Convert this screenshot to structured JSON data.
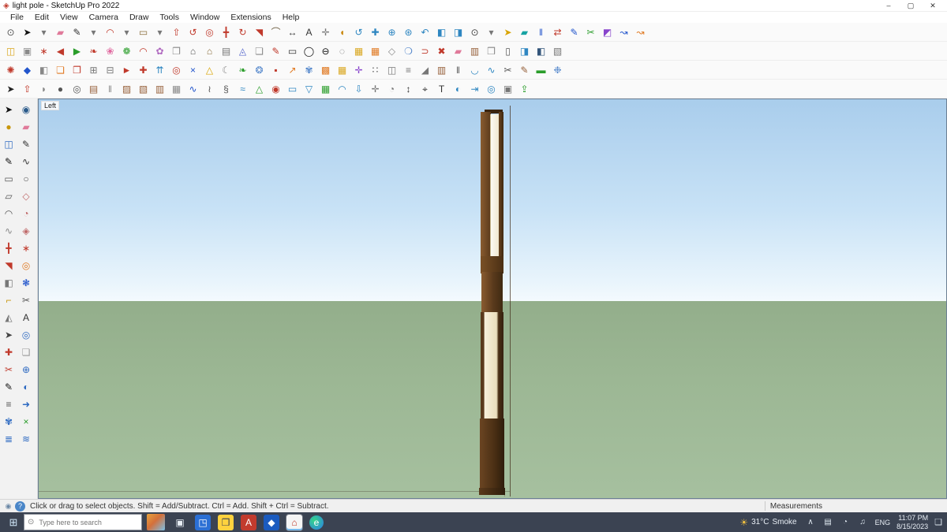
{
  "window": {
    "title": "light pole - SketchUp Pro 2022",
    "controls": {
      "minimize": "–",
      "maximize": "▢",
      "close": "✕"
    }
  },
  "menubar": {
    "items": [
      {
        "n": "menu-file",
        "label": "File"
      },
      {
        "n": "menu-edit",
        "label": "Edit"
      },
      {
        "n": "menu-view",
        "label": "View"
      },
      {
        "n": "menu-camera",
        "label": "Camera"
      },
      {
        "n": "menu-draw",
        "label": "Draw"
      },
      {
        "n": "menu-tools",
        "label": "Tools"
      },
      {
        "n": "menu-window",
        "label": "Window"
      },
      {
        "n": "menu-extensions",
        "label": "Extensions"
      },
      {
        "n": "menu-help",
        "label": "Help"
      }
    ]
  },
  "toolbars": {
    "row1": [
      {
        "n": "zoom-tool",
        "g": "⊙",
        "c": "#555"
      },
      {
        "n": "select",
        "g": "➤",
        "c": "#111"
      },
      {
        "n": "select-dropdown",
        "g": "▾",
        "c": "#777"
      },
      {
        "n": "eraser",
        "g": "▰",
        "c": "#e07a9a"
      },
      {
        "n": "line",
        "g": "✎",
        "c": "#333"
      },
      {
        "n": "line-dropdown",
        "g": "▾",
        "c": "#777"
      },
      {
        "n": "arc",
        "g": "◠",
        "c": "#c0392b"
      },
      {
        "n": "arc-dropdown",
        "g": "▾",
        "c": "#777"
      },
      {
        "n": "shapes",
        "g": "▭",
        "c": "#8a6d3b"
      },
      {
        "n": "shapes-dropdown",
        "g": "▾",
        "c": "#777"
      },
      {
        "n": "push-pull",
        "g": "⇧",
        "c": "#c0392b"
      },
      {
        "n": "follow-me",
        "g": "↺",
        "c": "#c0392b"
      },
      {
        "n": "offset",
        "g": "◎",
        "c": "#c0392b"
      },
      {
        "n": "move",
        "g": "╋",
        "c": "#c0392b"
      },
      {
        "n": "rotate",
        "g": "↻",
        "c": "#c0392b"
      },
      {
        "n": "scale",
        "g": "◥",
        "c": "#c0392b"
      },
      {
        "n": "tape-measure",
        "g": "⌒",
        "c": "#6b5b3e"
      },
      {
        "n": "dimension",
        "g": "↔",
        "c": "#333"
      },
      {
        "n": "text",
        "g": "A",
        "c": "#333"
      },
      {
        "n": "axes",
        "g": "✛",
        "c": "#777"
      },
      {
        "n": "paint-bucket",
        "g": "◖",
        "c": "#c8860a"
      },
      {
        "n": "orbit",
        "g": "↺",
        "c": "#2e86c1"
      },
      {
        "n": "pan",
        "g": "✚",
        "c": "#2e86c1"
      },
      {
        "n": "zoom-in",
        "g": "⊕",
        "c": "#2e86c1"
      },
      {
        "n": "zoom-extents",
        "g": "⊛",
        "c": "#2e86c1"
      },
      {
        "n": "previous-view",
        "g": "↶",
        "c": "#2e86c1"
      },
      {
        "n": "section-plane",
        "g": "◧",
        "c": "#2e86c1"
      },
      {
        "n": "section-fill",
        "g": "◨",
        "c": "#2e86c1"
      },
      {
        "n": "search",
        "g": "⊙",
        "c": "#444"
      },
      {
        "n": "search-dropdown",
        "g": "▾",
        "c": "#777"
      },
      {
        "n": "flip-yellow",
        "g": "➤",
        "c": "#d9a400"
      },
      {
        "n": "fill-teal",
        "g": "▰",
        "c": "#17a2a2"
      },
      {
        "n": "solid-tools",
        "g": "‖",
        "c": "#2255cc"
      },
      {
        "n": "swap-red-blue",
        "g": "⇄",
        "c": "#c0392b"
      },
      {
        "n": "pencil-blue",
        "g": "✎",
        "c": "#2255cc"
      },
      {
        "n": "scissors-green",
        "g": "✂",
        "c": "#2a9d2a"
      },
      {
        "n": "box-purple",
        "g": "◩",
        "c": "#8844cc"
      },
      {
        "n": "curl-blue",
        "g": "↝",
        "c": "#2255cc"
      },
      {
        "n": "curl-orange",
        "g": "↝",
        "c": "#e07820"
      }
    ],
    "row2": [
      {
        "n": "component-yellow",
        "g": "◫",
        "c": "#d9a61e"
      },
      {
        "n": "group-gray",
        "g": "▣",
        "c": "#8a8a8a"
      },
      {
        "n": "explode-red",
        "g": "∗",
        "c": "#c0392b"
      },
      {
        "n": "arrow-red",
        "g": "◀",
        "c": "#c0392b"
      },
      {
        "n": "arrow-green",
        "g": "▶",
        "c": "#2a9d2a"
      },
      {
        "n": "drop-red",
        "g": "❧",
        "c": "#c0392b"
      },
      {
        "n": "petal-pink",
        "g": "❀",
        "c": "#e06aa0"
      },
      {
        "n": "leaf-green",
        "g": "❁",
        "c": "#2a9d2a"
      },
      {
        "n": "arc-tool-red",
        "g": "◠",
        "c": "#c0392b"
      },
      {
        "n": "flower-violet",
        "g": "✿",
        "c": "#b06ac0"
      },
      {
        "n": "pages",
        "g": "❐",
        "c": "#888"
      },
      {
        "n": "house",
        "g": "⌂",
        "c": "#555"
      },
      {
        "n": "house-2",
        "g": "⌂",
        "c": "#8a6d3b"
      },
      {
        "n": "columns",
        "g": "▤",
        "c": "#777"
      },
      {
        "n": "fredoscale",
        "g": "◬",
        "c": "#5566cc"
      },
      {
        "n": "doc",
        "g": "❏",
        "c": "#888"
      },
      {
        "n": "pencil-red",
        "g": "✎",
        "c": "#c0392b"
      },
      {
        "n": "frame",
        "g": "▭",
        "c": "#333"
      },
      {
        "n": "oval-black",
        "g": "◯",
        "c": "#111"
      },
      {
        "n": "oval-filled",
        "g": "⊖",
        "c": "#111"
      },
      {
        "n": "oval-dashed",
        "g": "◌",
        "c": "#666"
      },
      {
        "n": "grid-yellow",
        "g": "▦",
        "c": "#d9a61e"
      },
      {
        "n": "grid-orange",
        "g": "▦",
        "c": "#e07820"
      },
      {
        "n": "hexagon",
        "g": "◇",
        "c": "#888"
      },
      {
        "n": "bubble-blue",
        "g": "❍",
        "c": "#5588cc"
      },
      {
        "n": "magnet-red",
        "g": "⊃",
        "c": "#c0392b"
      },
      {
        "n": "pin-red",
        "g": "✖",
        "c": "#c0392b"
      },
      {
        "n": "eraser-pink",
        "g": "▰",
        "c": "#e07a9a"
      },
      {
        "n": "panel-brown",
        "g": "▥",
        "c": "#96603a"
      },
      {
        "n": "book",
        "g": "❒",
        "c": "#888"
      },
      {
        "n": "door",
        "g": "▯",
        "c": "#555"
      },
      {
        "n": "display-blue",
        "g": "◨",
        "c": "#2e86c1"
      },
      {
        "n": "screen-navy",
        "g": "◧",
        "c": "#33557a"
      },
      {
        "n": "board-hatch",
        "g": "▧",
        "c": "#777"
      }
    ],
    "row3": [
      {
        "n": "burst-red",
        "g": "✺",
        "c": "#c0392b"
      },
      {
        "n": "diamond-blue",
        "g": "◆",
        "c": "#2255cc"
      },
      {
        "n": "half-square",
        "g": "◧",
        "c": "#888"
      },
      {
        "n": "page-orange",
        "g": "❏",
        "c": "#e07820"
      },
      {
        "n": "doc-red",
        "g": "❐",
        "c": "#c0392b"
      },
      {
        "n": "window-grid",
        "g": "⊞",
        "c": "#777"
      },
      {
        "n": "window-minus",
        "g": "⊟",
        "c": "#777"
      },
      {
        "n": "flag-red",
        "g": "►",
        "c": "#c0392b"
      },
      {
        "n": "cross-red",
        "g": "✚",
        "c": "#c0392b"
      },
      {
        "n": "arrows-up",
        "g": "⇈",
        "c": "#2e86c1"
      },
      {
        "n": "target-red",
        "g": "◎",
        "c": "#c0392b"
      },
      {
        "n": "x-blue",
        "g": "×",
        "c": "#2255cc"
      },
      {
        "n": "warning-triangle",
        "g": "△",
        "c": "#d9a400"
      },
      {
        "n": "moon",
        "g": "☾",
        "c": "#888"
      },
      {
        "n": "leaf-2",
        "g": "❧",
        "c": "#2a9d2a"
      },
      {
        "n": "wheel-blue",
        "g": "❂",
        "c": "#5588cc"
      },
      {
        "n": "box-red-small",
        "g": "▪",
        "c": "#c0392b"
      },
      {
        "n": "arrow-diag-orange",
        "g": "↗",
        "c": "#e07820"
      },
      {
        "n": "swirl-blue",
        "g": "✾",
        "c": "#5588cc"
      },
      {
        "n": "grid-orange-2",
        "g": "▩",
        "c": "#e07820"
      },
      {
        "n": "grid-gold",
        "g": "▦",
        "c": "#d9a61e"
      },
      {
        "n": "plus-purple",
        "g": "✛",
        "c": "#8844cc"
      },
      {
        "n": "dots-grid",
        "g": "∷",
        "c": "#555"
      },
      {
        "n": "cube-outline",
        "g": "◫",
        "c": "#777"
      },
      {
        "n": "stairs",
        "g": "≡",
        "c": "#777"
      },
      {
        "n": "ramp",
        "g": "◢",
        "c": "#777"
      },
      {
        "n": "fence-brown",
        "g": "▥",
        "c": "#96603a"
      },
      {
        "n": "pipes",
        "g": "‖",
        "c": "#555"
      },
      {
        "n": "arc-blue",
        "g": "◡",
        "c": "#2e86c1"
      },
      {
        "n": "wave-blue",
        "g": "∿",
        "c": "#2e86c1"
      },
      {
        "n": "scissors",
        "g": "✂",
        "c": "#555"
      },
      {
        "n": "brush-brown",
        "g": "✎",
        "c": "#96603a"
      },
      {
        "n": "roller-green",
        "g": "▬",
        "c": "#2a9d2a"
      },
      {
        "n": "spray-blue",
        "g": "❉",
        "c": "#5588cc"
      }
    ],
    "row4": [
      {
        "n": "select-2",
        "g": "➤",
        "c": "#222"
      },
      {
        "n": "push-red",
        "g": "⇧",
        "c": "#c0392b"
      },
      {
        "n": "shell",
        "g": "◗",
        "c": "#888"
      },
      {
        "n": "disc",
        "g": "●",
        "c": "#555"
      },
      {
        "n": "donut",
        "g": "◎",
        "c": "#555"
      },
      {
        "n": "panel-wood",
        "g": "▤",
        "c": "#96603a"
      },
      {
        "n": "pipe-pair",
        "g": "‖",
        "c": "#888"
      },
      {
        "n": "board-diag",
        "g": "▨",
        "c": "#96603a"
      },
      {
        "n": "board-diag-2",
        "g": "▧",
        "c": "#96603a"
      },
      {
        "n": "fence-2",
        "g": "▥",
        "c": "#96603a"
      },
      {
        "n": "grid-2",
        "g": "▦",
        "c": "#888"
      },
      {
        "n": "curve-blue",
        "g": "∿",
        "c": "#2255cc"
      },
      {
        "n": "spring",
        "g": "≀",
        "c": "#555"
      },
      {
        "n": "helix",
        "g": "§",
        "c": "#555"
      },
      {
        "n": "wave-2",
        "g": "≈",
        "c": "#2e86c1"
      },
      {
        "n": "terrain",
        "g": "△",
        "c": "#2a9d2a"
      },
      {
        "n": "stamp-red",
        "g": "◉",
        "c": "#c0392b"
      },
      {
        "n": "flatten",
        "g": "▭",
        "c": "#2e86c1"
      },
      {
        "n": "drape",
        "g": "▽",
        "c": "#2e86c1"
      },
      {
        "n": "mesh-green",
        "g": "▦",
        "c": "#2a9d2a"
      },
      {
        "n": "smooth-arc",
        "g": "◠",
        "c": "#2e86c1"
      },
      {
        "n": "arrow-down",
        "g": "⇩",
        "c": "#2e86c1"
      },
      {
        "n": "axes-2",
        "g": "✛",
        "c": "#777"
      },
      {
        "n": "protractor",
        "g": "◔",
        "c": "#777"
      },
      {
        "n": "dim-vertical",
        "g": "↕",
        "c": "#333"
      },
      {
        "n": "label-tag",
        "g": "⌖",
        "c": "#333"
      },
      {
        "n": "text-3d",
        "g": "T",
        "c": "#333"
      },
      {
        "n": "look-around",
        "g": "◐",
        "c": "#2e86c1"
      },
      {
        "n": "walk",
        "g": "⇥",
        "c": "#2e86c1"
      },
      {
        "n": "position-camera",
        "g": "◎",
        "c": "#2e86c1"
      },
      {
        "n": "image-frame",
        "g": "▣",
        "c": "#777"
      },
      {
        "n": "export-up",
        "g": "⇪",
        "c": "#2a9d2a"
      }
    ],
    "left": [
      {
        "n": "select",
        "g": "➤",
        "c": "#111"
      },
      {
        "n": "orbit-eye",
        "g": "◉",
        "c": "#2a5a8a"
      },
      {
        "n": "coin-gold",
        "g": "●",
        "c": "#c8960a"
      },
      {
        "n": "card-pink",
        "g": "▰",
        "c": "#e07a9a"
      },
      {
        "n": "cube-blue",
        "g": "◫",
        "c": "#2e6ac1"
      },
      {
        "n": "pencil",
        "g": "✎",
        "c": "#333"
      },
      {
        "n": "pencil-2",
        "g": "✎",
        "c": "#111"
      },
      {
        "n": "freehand",
        "g": "∿",
        "c": "#333"
      },
      {
        "n": "rectangle",
        "g": "▭",
        "c": "#555"
      },
      {
        "n": "circle",
        "g": "○",
        "c": "#555"
      },
      {
        "n": "rotated-rect",
        "g": "▱",
        "c": "#555"
      },
      {
        "n": "polygon",
        "g": "◇",
        "c": "#c06a6a"
      },
      {
        "n": "arc-tool",
        "g": "◠",
        "c": "#555"
      },
      {
        "n": "pie",
        "g": "◔",
        "c": "#c06a6a"
      },
      {
        "n": "curve",
        "g": "∿",
        "c": "#888"
      },
      {
        "n": "diamond-pink",
        "g": "◈",
        "c": "#c06a6a"
      },
      {
        "n": "move",
        "g": "╋",
        "c": "#c0392b"
      },
      {
        "n": "burst",
        "g": "∗",
        "c": "#c0392b"
      },
      {
        "n": "scale",
        "g": "◥",
        "c": "#c0392b"
      },
      {
        "n": "offset-orange",
        "g": "◎",
        "c": "#e07820"
      },
      {
        "n": "half-grid",
        "g": "◧",
        "c": "#777"
      },
      {
        "n": "flower-blue",
        "g": "❃",
        "c": "#2255cc"
      },
      {
        "n": "key-gold",
        "g": "⌐",
        "c": "#c8960a"
      },
      {
        "n": "scissors",
        "g": "✂",
        "c": "#555"
      },
      {
        "n": "triangle-half",
        "g": "◭",
        "c": "#777"
      },
      {
        "n": "text-box",
        "g": "A",
        "c": "#333"
      },
      {
        "n": "select-small",
        "g": "➤",
        "c": "#444"
      },
      {
        "n": "orbit-blue",
        "g": "◎",
        "c": "#2e6ac1"
      },
      {
        "n": "pin-cross",
        "g": "✚",
        "c": "#c0392b"
      },
      {
        "n": "paper",
        "g": "❏",
        "c": "#999"
      },
      {
        "n": "cut",
        "g": "✂",
        "c": "#c0392b"
      },
      {
        "n": "zoom-blue",
        "g": "⊕",
        "c": "#2e6ac1"
      },
      {
        "n": "pen-black",
        "g": "✎",
        "c": "#111"
      },
      {
        "n": "look",
        "g": "◐",
        "c": "#2e6ac1"
      },
      {
        "n": "bars",
        "g": "≡",
        "c": "#555"
      },
      {
        "n": "walk-arrow",
        "g": "➜",
        "c": "#2e6ac1"
      },
      {
        "n": "swirl",
        "g": "✾",
        "c": "#2e6ac1"
      },
      {
        "n": "x-green",
        "g": "×",
        "c": "#2a9d2a"
      },
      {
        "n": "layers-blue",
        "g": "≣",
        "c": "#2e6ac1"
      },
      {
        "n": "waves-blue",
        "g": "≋",
        "c": "#2e6ac1"
      }
    ]
  },
  "viewport": {
    "view_label": "Left"
  },
  "statusbar": {
    "icons": [
      {
        "n": "geolocation",
        "g": "◉",
        "c": "#6a87a5"
      },
      {
        "n": "help",
        "g": "?",
        "c": "#fff",
        "bg": "#4a86c8",
        "cls": "round"
      }
    ],
    "hint": "Click or drag to select objects. Shift = Add/Subtract. Ctrl = Add. Shift + Ctrl = Subtract.",
    "measurements_label": "Measurements"
  },
  "taskbar": {
    "start_glyph": "⊞",
    "search_icon_glyph": "⊙",
    "search_placeholder": "Type here to search",
    "apps": [
      {
        "n": "search-highlights",
        "g": "",
        "bg": "linear-gradient(135deg,#e8a33d 0%,#d4703a 45%,#7ac0e8 100%)",
        "cls": "thumb"
      },
      {
        "n": "task-view",
        "g": "▣",
        "c": "#e8eef5"
      },
      {
        "n": "blue-window-app",
        "g": "◳",
        "c": "#fff",
        "bg": "#2b6fd4"
      },
      {
        "n": "file-explorer",
        "g": "❒",
        "c": "#3b4352",
        "bg": "#ffd23e"
      },
      {
        "n": "red-a-app",
        "g": "A",
        "c": "#fff",
        "bg": "#c23b2e"
      },
      {
        "n": "blue-app",
        "g": "◆",
        "c": "#fff",
        "bg": "#1b5bbf"
      },
      {
        "n": "sketchup",
        "g": "⌂",
        "c": "#c0392b",
        "bg": "#f5f5f5",
        "cls": "active"
      },
      {
        "n": "edge-browser",
        "g": "e",
        "c": "#fff",
        "bg": "radial-gradient(circle at 35% 35%, #35d687, #2b7de9)",
        "cls": "round"
      }
    ],
    "tray": {
      "weather_icon_glyph": "☀",
      "weather_temp": "31°C",
      "weather_desc": "Smoke",
      "icons": [
        {
          "n": "hidden-icons-chevron",
          "g": "∧",
          "c": "#dfe8f0"
        },
        {
          "n": "touch-keyboard",
          "g": "▤",
          "c": "#dfe8f0"
        },
        {
          "n": "network",
          "g": "◔",
          "c": "#dfe8f0"
        },
        {
          "n": "volume",
          "g": "♫",
          "c": "#dfe8f0"
        }
      ],
      "lang": "ENG",
      "time": "11:07 PM",
      "date": "8/15/2023",
      "notification_glyph": "❏"
    }
  }
}
